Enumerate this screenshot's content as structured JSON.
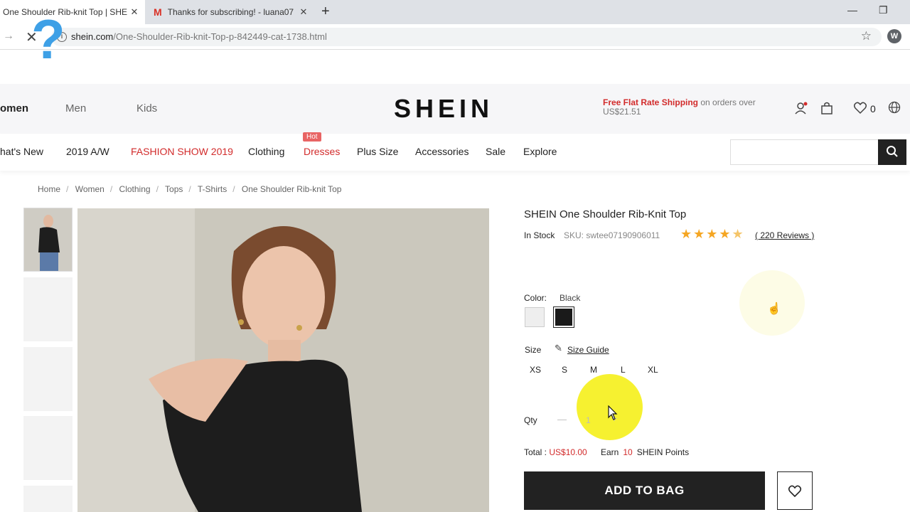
{
  "browser": {
    "tabs": [
      {
        "title": "One Shoulder Rib-knit Top | SHEI",
        "close": "✕"
      },
      {
        "title": "Thanks for subscribing! - luana07",
        "close": "✕",
        "icon": "gmail-icon"
      }
    ],
    "new_tab": "+",
    "url_host": "shein.com",
    "url_path": "/One-Shoulder-Rib-knit-Top-p-842449-cat-1738.html",
    "profile_initial": "W"
  },
  "header": {
    "categories": [
      "omen",
      "Men",
      "Kids"
    ],
    "logo": "SHEIN",
    "shipping_highlight": "Free Flat Rate Shipping",
    "shipping_rest": " on orders over US$21.51",
    "wishlist_count": "0"
  },
  "nav": {
    "items": [
      "hat's New",
      "2019 A/W",
      "FASHION SHOW 2019",
      "Clothing",
      "Dresses",
      "Plus Size",
      "Accessories",
      "Sale",
      "Explore"
    ],
    "hot_badge": "Hot"
  },
  "breadcrumb": [
    "Home",
    "Women",
    "Clothing",
    "Tops",
    "T-Shirts",
    "One Shoulder Rib-knit Top"
  ],
  "product": {
    "title": "SHEIN One Shoulder Rib-Knit Top",
    "stock": "In Stock",
    "sku": "SKU: swtee07190906011",
    "rating": 4.5,
    "reviews": "( 220 Reviews )",
    "color_label": "Color:",
    "color_value": "Black",
    "size_label": "Size",
    "size_guide": "Size Guide",
    "sizes": [
      "XS",
      "S",
      "M",
      "L",
      "XL"
    ],
    "qty_label": "Qty",
    "qty_minus": "—",
    "qty_value": "1",
    "qty_plus": "+",
    "total_label": "Total : ",
    "total_value": "US$10.00",
    "earn_label": "Earn",
    "earn_points": "10",
    "points_label": "SHEIN Points",
    "add_to_bag": "ADD TO BAG"
  },
  "colors": {
    "accent_red": "#d22b2b",
    "button_dark": "#222222",
    "highlight_yellow": "#f5ef1a"
  }
}
